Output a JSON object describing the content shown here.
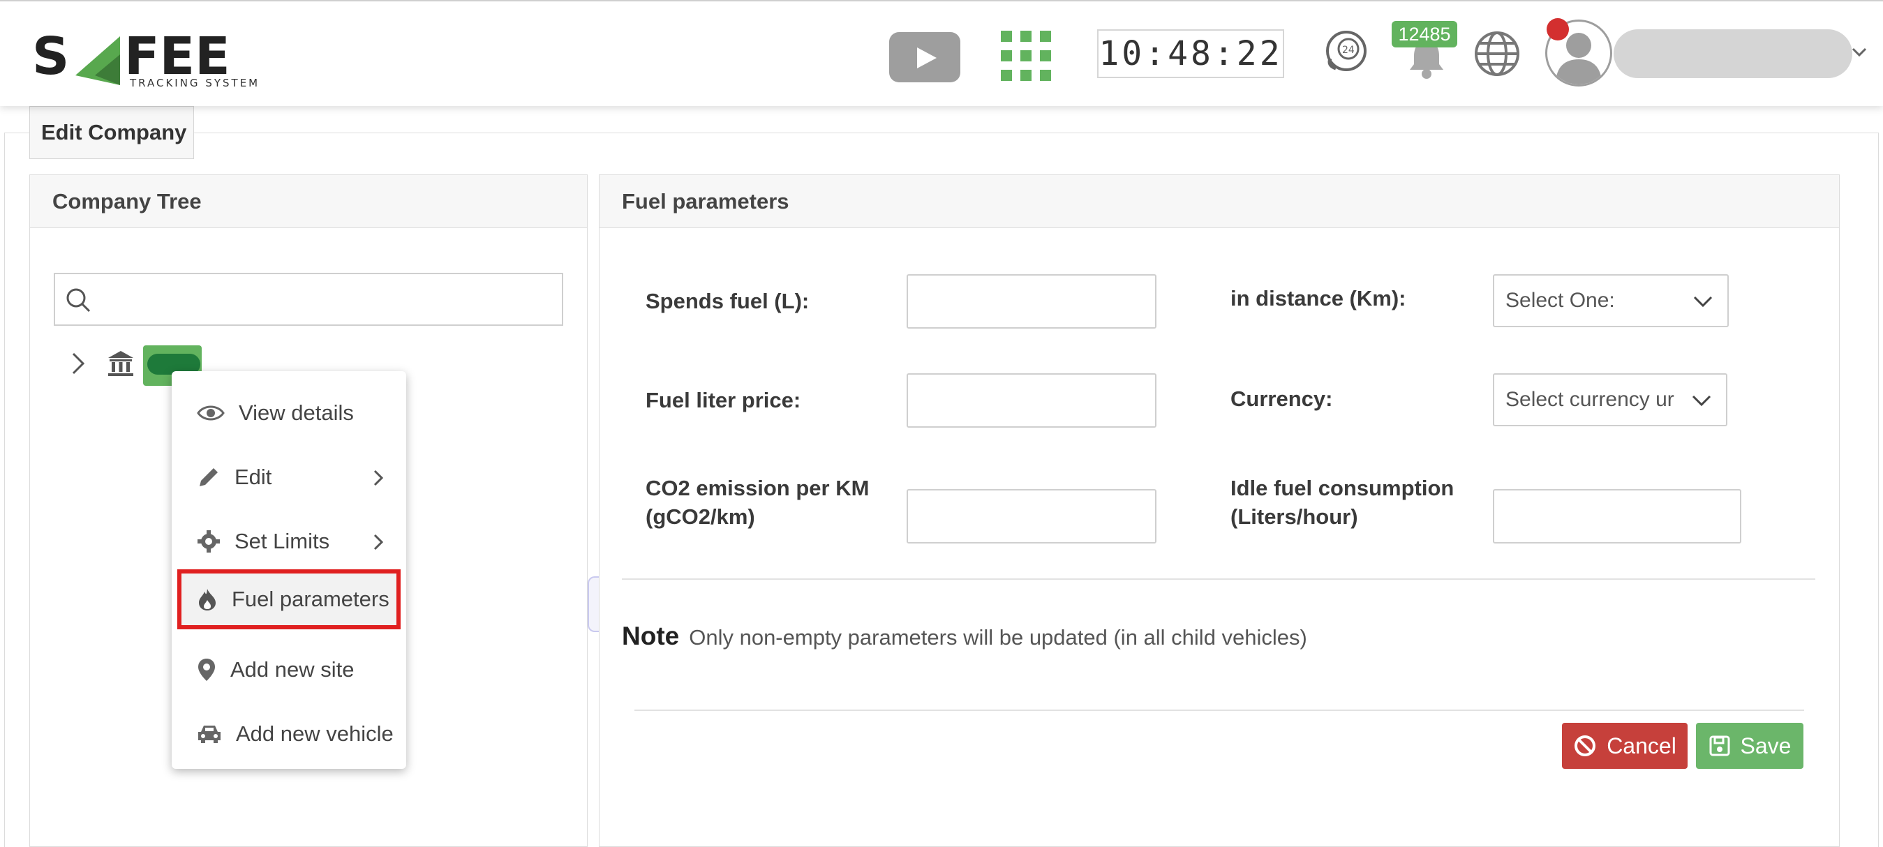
{
  "header": {
    "logo": {
      "wordmark": "SAFEE",
      "tagline": "TRACKING SYSTEM"
    },
    "clock": "10:48:22",
    "notifications_count": "12485",
    "icons": [
      "play-icon",
      "apps-grid-icon",
      "support-24-icon",
      "bell-icon",
      "globe-icon",
      "user-avatar-icon",
      "chevron-down-icon"
    ]
  },
  "page": {
    "tab_title": "Edit Company"
  },
  "tree": {
    "title": "Company Tree",
    "search_placeholder": ""
  },
  "context_menu": {
    "items": [
      {
        "label": "View details",
        "icon": "eye-icon",
        "has_submenu": false
      },
      {
        "label": "Edit",
        "icon": "pencil-icon",
        "has_submenu": true
      },
      {
        "label": "Set Limits",
        "icon": "gear-icon",
        "has_submenu": true
      },
      {
        "label": "Fuel parameters",
        "icon": "flame-icon",
        "has_submenu": false,
        "highlighted": true
      },
      {
        "label": "Add new site",
        "icon": "map-pin-icon",
        "has_submenu": false
      },
      {
        "label": "Add new vehicle",
        "icon": "car-icon",
        "has_submenu": false
      }
    ]
  },
  "fuel": {
    "title": "Fuel parameters",
    "spends_fuel_label": "Spends fuel (L):",
    "spends_fuel_value": "",
    "in_distance_label": "in distance (Km):",
    "in_distance_select": "Select One:",
    "liter_price_label": "Fuel liter price:",
    "liter_price_value": "",
    "currency_label": "Currency:",
    "currency_select": "Select currency ur",
    "co2_label_line1": "CO2 emission per KM",
    "co2_label_line2": "(gCO2/km)",
    "co2_value": "",
    "idle_label_line1": "Idle fuel consumption",
    "idle_label_line2": "(Liters/hour)",
    "idle_value": "",
    "note_title": "Note",
    "note_text": "Only non-empty parameters will be updated (in all child vehicles)",
    "cancel_label": "Cancel",
    "save_label": "Save"
  },
  "colors": {
    "brand_green": "#62b35e",
    "cancel_red": "#c6403b",
    "save_green": "#6bb66a",
    "highlight_red": "#e02020",
    "notification_dot": "#d32f2f"
  }
}
